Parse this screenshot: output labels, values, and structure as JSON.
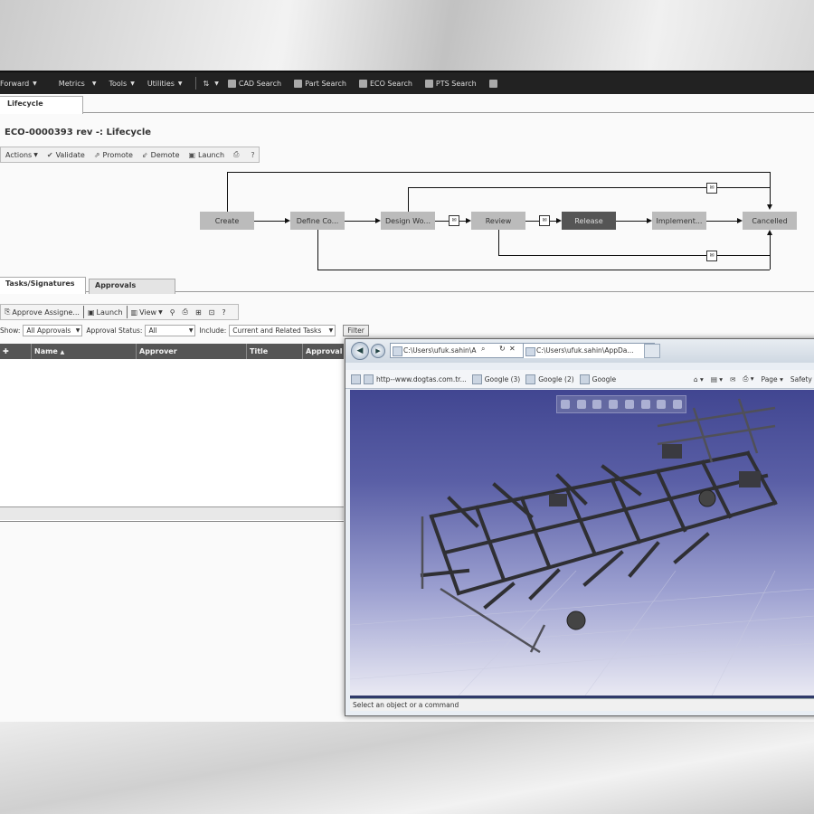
{
  "menubar": {
    "items": [
      {
        "label": "Forward",
        "caret": true
      },
      {
        "label": "Metrics",
        "caret": true
      },
      {
        "label": "Tools",
        "caret": true
      },
      {
        "label": "Utilities",
        "caret": true
      }
    ],
    "searches": [
      {
        "label": "CAD Search",
        "icon": "cad-search-icon"
      },
      {
        "label": "Part Search",
        "icon": "part-search-icon"
      },
      {
        "label": "ECO Search",
        "icon": "eco-search-icon"
      },
      {
        "label": "PTS Search",
        "icon": "pts-search-icon"
      }
    ]
  },
  "tab": {
    "label": "Lifecycle"
  },
  "page": {
    "title": "ECO-0000393 rev -: Lifecycle"
  },
  "toolbar": {
    "actions": "Actions",
    "validate": "Validate",
    "promote": "Promote",
    "demote": "Demote",
    "launch": "Launch"
  },
  "workflow": {
    "nodes": [
      "Create",
      "Define Co...",
      "Design Wo...",
      "Review",
      "Release",
      "Implement...",
      "Cancelled"
    ],
    "active": "Release"
  },
  "tabs2": {
    "tasks": "Tasks/Signatures",
    "approvals": "Approvals"
  },
  "toolbar2": {
    "approve": "Approve Assigne...",
    "launch": "Launch",
    "view": "View"
  },
  "filters": {
    "show_label": "Show:",
    "show_value": "All Approvals",
    "status_label": "Approval Status:",
    "status_value": "All",
    "include_label": "Include:",
    "include_value": "Current and Related Tasks",
    "filter_button": "Filter"
  },
  "grid": {
    "columns": [
      "Name",
      "Approver",
      "Title",
      "Approval"
    ],
    "sort_indicator": "▲"
  },
  "browser": {
    "address": "C:\\Users\\ufuk.sahin\\A",
    "tab_title": "C:\\Users\\ufuk.sahin\\AppDa...",
    "favorites": [
      "http--www.dogtas.com.tr...",
      "Google (3)",
      "Google (2)",
      "Google"
    ],
    "menus": [
      "Page",
      "Safety"
    ],
    "status": "Select an object or a command"
  },
  "colors": {
    "menubar": "#222222",
    "active_node": "#555555",
    "node": "#bbbbbb",
    "viewport_top": "#414691"
  }
}
